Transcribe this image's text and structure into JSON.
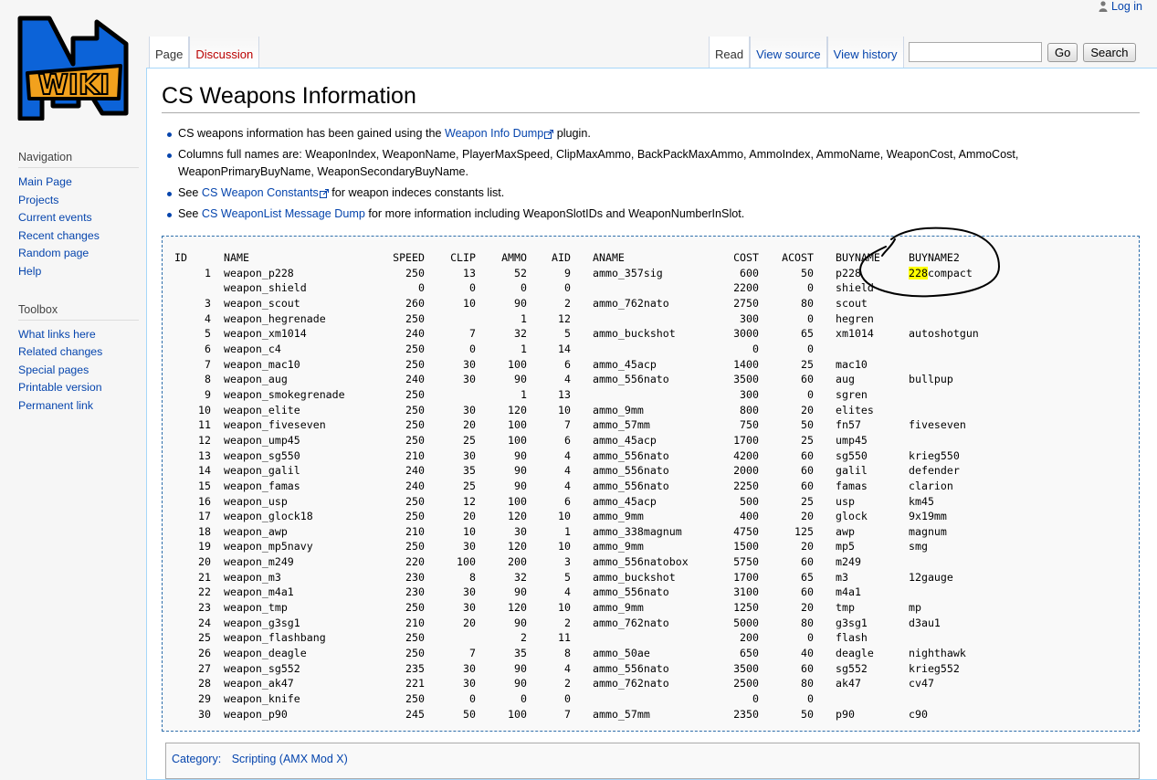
{
  "personal": {
    "login": "Log in"
  },
  "logo": {
    "text": "WIKI"
  },
  "tabs": {
    "left": [
      {
        "label": "Page",
        "selected": true
      },
      {
        "label": "Discussion",
        "new": true
      }
    ],
    "right": [
      {
        "label": "Read",
        "selected": true
      },
      {
        "label": "View source"
      },
      {
        "label": "View history"
      }
    ]
  },
  "search": {
    "value": "",
    "go": "Go",
    "search": "Search"
  },
  "sidebar": {
    "navigation": {
      "title": "Navigation",
      "items": [
        "Main Page",
        "Projects",
        "Current events",
        "Recent changes",
        "Random page",
        "Help"
      ]
    },
    "toolbox": {
      "title": "Toolbox",
      "items": [
        "What links here",
        "Related changes",
        "Special pages",
        "Printable version",
        "Permanent link"
      ]
    }
  },
  "page": {
    "title": "CS Weapons Information",
    "bullets": [
      {
        "pre": "CS weapons information has been gained using the ",
        "link": "Weapon Info Dump",
        "external": true,
        "post": " plugin."
      },
      {
        "pre": "Columns full names are: WeaponIndex, WeaponName, PlayerMaxSpeed, ClipMaxAmmo, BackPackMaxAmmo, AmmoIndex, AmmoName, WeaponCost, AmmoCost, WeaponPrimaryBuyName, WeaponSecondaryBuyName.",
        "link": "",
        "external": false,
        "post": ""
      },
      {
        "pre": "See ",
        "link": "CS Weapon Constants",
        "external": true,
        "post": " for weapon indeces constants list."
      },
      {
        "pre": "See ",
        "link": "CS WeaponList Message Dump",
        "external": false,
        "post": " for more information including WeaponSlotIDs and WeaponNumberInSlot."
      }
    ],
    "table": {
      "headers": [
        "ID",
        "NAME",
        "SPEED",
        "CLIP",
        "AMMO",
        "AID",
        "ANAME",
        "COST",
        "ACOST",
        "BUYNAME",
        "BUYNAME2"
      ],
      "rows": [
        [
          "1",
          "weapon_p228",
          "250",
          "13",
          "52",
          "9",
          "ammo_357sig",
          "600",
          "50",
          "p228",
          "228compact"
        ],
        [
          "",
          "weapon_shield",
          "0",
          "0",
          "0",
          "0",
          "",
          "2200",
          "0",
          "shield",
          ""
        ],
        [
          "3",
          "weapon_scout",
          "260",
          "10",
          "90",
          "2",
          "ammo_762nato",
          "2750",
          "80",
          "scout",
          ""
        ],
        [
          "4",
          "weapon_hegrenade",
          "250",
          "",
          "1",
          "12",
          "",
          "300",
          "0",
          "hegren",
          ""
        ],
        [
          "5",
          "weapon_xm1014",
          "240",
          "7",
          "32",
          "5",
          "ammo_buckshot",
          "3000",
          "65",
          "xm1014",
          "autoshotgun"
        ],
        [
          "6",
          "weapon_c4",
          "250",
          "0",
          "1",
          "14",
          "",
          "0",
          "0",
          "",
          ""
        ],
        [
          "7",
          "weapon_mac10",
          "250",
          "30",
          "100",
          "6",
          "ammo_45acp",
          "1400",
          "25",
          "mac10",
          ""
        ],
        [
          "8",
          "weapon_aug",
          "240",
          "30",
          "90",
          "4",
          "ammo_556nato",
          "3500",
          "60",
          "aug",
          "bullpup"
        ],
        [
          "9",
          "weapon_smokegrenade",
          "250",
          "",
          "1",
          "13",
          "",
          "300",
          "0",
          "sgren",
          ""
        ],
        [
          "10",
          "weapon_elite",
          "250",
          "30",
          "120",
          "10",
          "ammo_9mm",
          "800",
          "20",
          "elites",
          ""
        ],
        [
          "11",
          "weapon_fiveseven",
          "250",
          "20",
          "100",
          "7",
          "ammo_57mm",
          "750",
          "50",
          "fn57",
          "fiveseven"
        ],
        [
          "12",
          "weapon_ump45",
          "250",
          "25",
          "100",
          "6",
          "ammo_45acp",
          "1700",
          "25",
          "ump45",
          ""
        ],
        [
          "13",
          "weapon_sg550",
          "210",
          "30",
          "90",
          "4",
          "ammo_556nato",
          "4200",
          "60",
          "sg550",
          "krieg550"
        ],
        [
          "14",
          "weapon_galil",
          "240",
          "35",
          "90",
          "4",
          "ammo_556nato",
          "2000",
          "60",
          "galil",
          "defender"
        ],
        [
          "15",
          "weapon_famas",
          "240",
          "25",
          "90",
          "4",
          "ammo_556nato",
          "2250",
          "60",
          "famas",
          "clarion"
        ],
        [
          "16",
          "weapon_usp",
          "250",
          "12",
          "100",
          "6",
          "ammo_45acp",
          "500",
          "25",
          "usp",
          "km45"
        ],
        [
          "17",
          "weapon_glock18",
          "250",
          "20",
          "120",
          "10",
          "ammo_9mm",
          "400",
          "20",
          "glock",
          "9x19mm"
        ],
        [
          "18",
          "weapon_awp",
          "210",
          "10",
          "30",
          "1",
          "ammo_338magnum",
          "4750",
          "125",
          "awp",
          "magnum"
        ],
        [
          "19",
          "weapon_mp5navy",
          "250",
          "30",
          "120",
          "10",
          "ammo_9mm",
          "1500",
          "20",
          "mp5",
          "smg"
        ],
        [
          "20",
          "weapon_m249",
          "220",
          "100",
          "200",
          "3",
          "ammo_556natobox",
          "5750",
          "60",
          "m249",
          ""
        ],
        [
          "21",
          "weapon_m3",
          "230",
          "8",
          "32",
          "5",
          "ammo_buckshot",
          "1700",
          "65",
          "m3",
          "12gauge"
        ],
        [
          "22",
          "weapon_m4a1",
          "230",
          "30",
          "90",
          "4",
          "ammo_556nato",
          "3100",
          "60",
          "m4a1",
          ""
        ],
        [
          "23",
          "weapon_tmp",
          "250",
          "30",
          "120",
          "10",
          "ammo_9mm",
          "1250",
          "20",
          "tmp",
          "mp"
        ],
        [
          "24",
          "weapon_g3sg1",
          "210",
          "20",
          "90",
          "2",
          "ammo_762nato",
          "5000",
          "80",
          "g3sg1",
          "d3au1"
        ],
        [
          "25",
          "weapon_flashbang",
          "250",
          "",
          "2",
          "11",
          "",
          "200",
          "0",
          "flash",
          ""
        ],
        [
          "26",
          "weapon_deagle",
          "250",
          "7",
          "35",
          "8",
          "ammo_50ae",
          "650",
          "40",
          "deagle",
          "nighthawk"
        ],
        [
          "27",
          "weapon_sg552",
          "235",
          "30",
          "90",
          "4",
          "ammo_556nato",
          "3500",
          "60",
          "sg552",
          "krieg552"
        ],
        [
          "28",
          "weapon_ak47",
          "221",
          "30",
          "90",
          "2",
          "ammo_762nato",
          "2500",
          "80",
          "ak47",
          "cv47"
        ],
        [
          "29",
          "weapon_knife",
          "250",
          "0",
          "0",
          "0",
          "",
          "0",
          "0",
          "",
          ""
        ],
        [
          "30",
          "weapon_p90",
          "245",
          "50",
          "100",
          "7",
          "ammo_57mm",
          "2350",
          "50",
          "p90",
          "c90"
        ]
      ],
      "highlight": {
        "row": 0,
        "text": "228",
        "rest": "compact"
      }
    },
    "category": {
      "label": "Category:",
      "link": "Scripting (AMX Mod X)"
    }
  }
}
